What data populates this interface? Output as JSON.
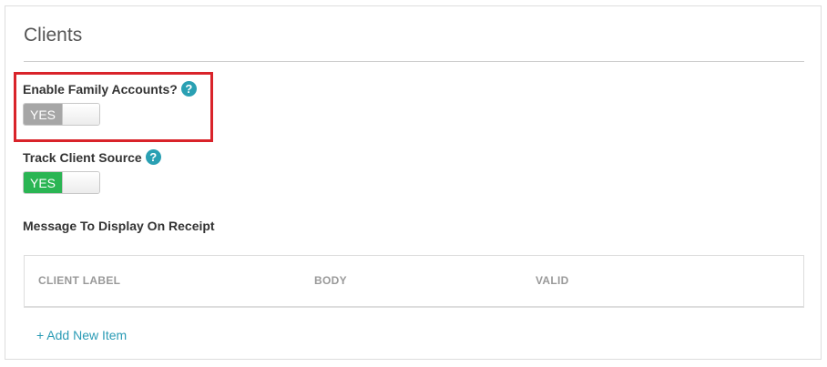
{
  "section": {
    "title": "Clients"
  },
  "settings": {
    "family_accounts": {
      "label": "Enable Family Accounts?",
      "help_glyph": "?",
      "toggle_label": "YES",
      "toggle_color": "#a6a6a6",
      "enabled": false
    },
    "track_client_source": {
      "label": "Track Client Source",
      "help_glyph": "?",
      "toggle_label": "YES",
      "toggle_color": "#2ab553",
      "enabled": true
    }
  },
  "receipt_messages": {
    "label": "Message To Display On Receipt",
    "columns": [
      "CLIENT LABEL",
      "BODY",
      "VALID"
    ],
    "rows": [],
    "add_label": "+ Add New Item"
  },
  "colors": {
    "accent": "#2aa0b3",
    "highlight": "#d9232a"
  },
  "icons": {
    "help": "question-mark-circle"
  }
}
